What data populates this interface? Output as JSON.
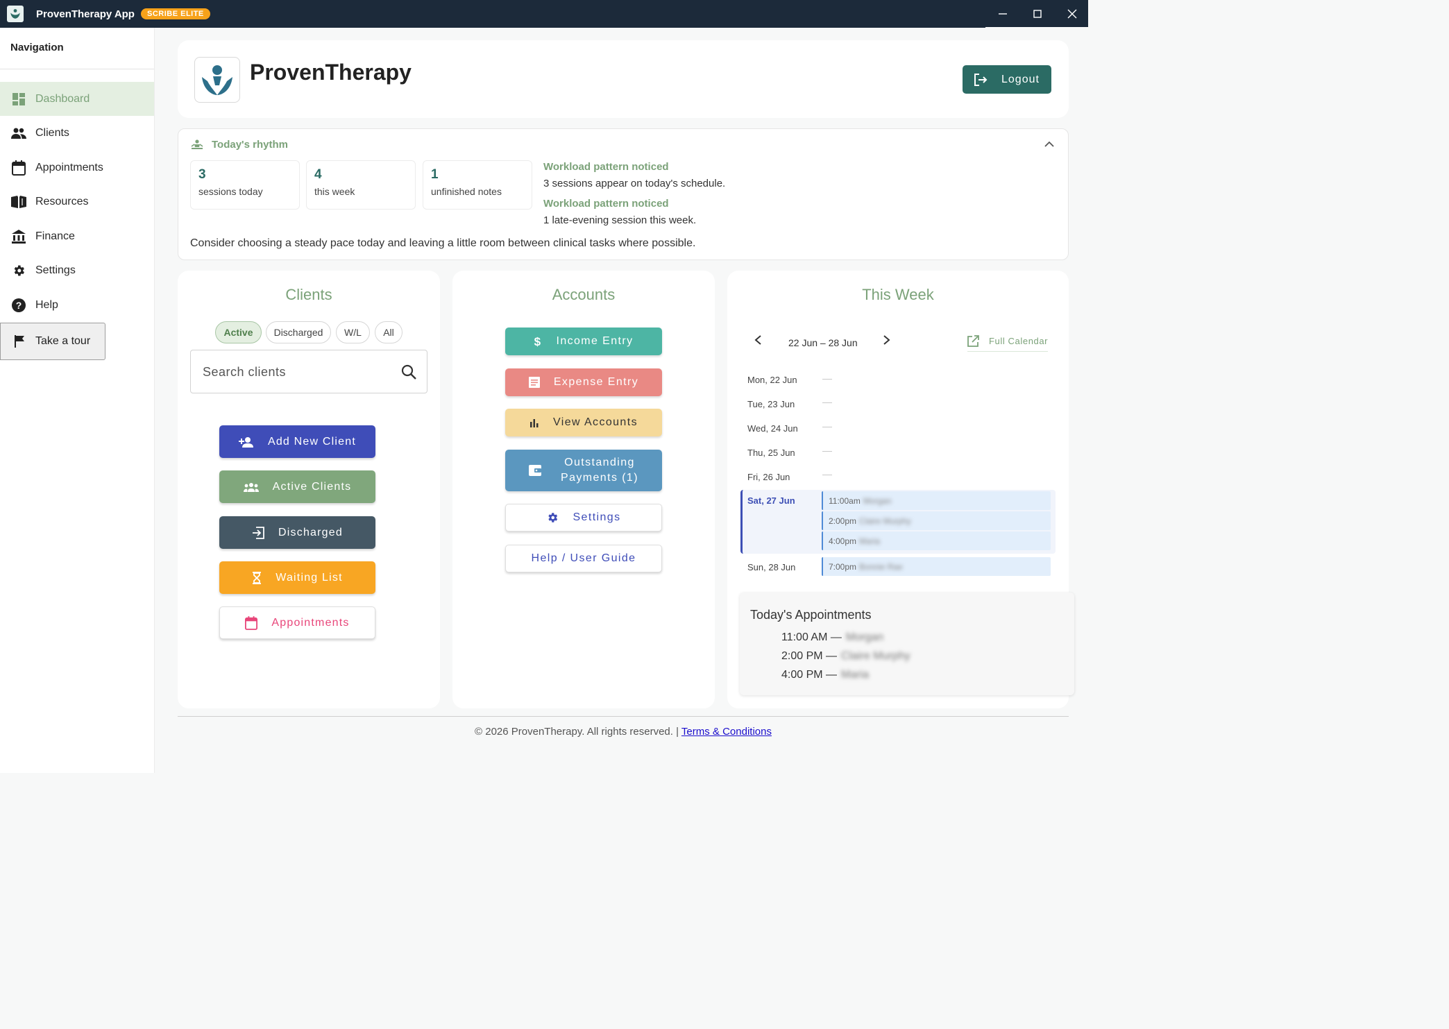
{
  "window": {
    "title": "ProvenTherapy App",
    "badge": "SCRIBE ELITE"
  },
  "sidebar": {
    "title": "Navigation",
    "items": [
      {
        "label": "Dashboard",
        "icon": "dashboard-icon",
        "active": true
      },
      {
        "label": "Clients",
        "icon": "people-icon"
      },
      {
        "label": "Appointments",
        "icon": "calendar-icon"
      },
      {
        "label": "Resources",
        "icon": "book-icon"
      },
      {
        "label": "Finance",
        "icon": "bank-icon"
      },
      {
        "label": "Settings",
        "icon": "gear-icon"
      },
      {
        "label": "Help",
        "icon": "help-icon"
      }
    ],
    "tour_label": "Take a tour"
  },
  "header": {
    "brand": "ProvenTherapy",
    "logout_label": "Logout"
  },
  "rhythm": {
    "title": "Today's rhythm",
    "stats": [
      {
        "value": "3",
        "caption": "sessions today"
      },
      {
        "value": "4",
        "caption": "this week"
      },
      {
        "value": "1",
        "caption": "unfinished notes"
      }
    ],
    "insights": [
      {
        "title": "Workload pattern noticed",
        "text": "3 sessions appear on today's schedule."
      },
      {
        "title": "Workload pattern noticed",
        "text": "1 late-evening session this week."
      }
    ],
    "tip": "Consider choosing a steady pace today and leaving a little room between clinical tasks where possible."
  },
  "clients": {
    "title": "Clients",
    "filters": [
      "Active",
      "Discharged",
      "W/L",
      "All"
    ],
    "active_filter": "Active",
    "search_placeholder": "Search clients",
    "buttons": [
      {
        "label": "Add New Client",
        "icon": "person-add-icon",
        "color": "#3f4db8"
      },
      {
        "label": "Active Clients",
        "icon": "group-icon",
        "color": "#80a77c"
      },
      {
        "label": "Discharged",
        "icon": "exit-icon",
        "color": "#455865"
      },
      {
        "label": "Waiting List",
        "icon": "hourglass-icon",
        "color": "#f8a623"
      },
      {
        "label": "Appointments",
        "icon": "calendar-icon",
        "color": "#e8467a"
      }
    ]
  },
  "accounts": {
    "title": "Accounts",
    "buttons": [
      {
        "label": "Income Entry",
        "icon": "dollar-icon",
        "color": "#4db5a4"
      },
      {
        "label": "Expense Entry",
        "icon": "receipt-icon",
        "color": "#e98984"
      },
      {
        "label": "View Accounts",
        "icon": "bar-chart-icon",
        "color": "#f5d99a"
      },
      {
        "label": "Outstanding Payments (1)",
        "label_line1": "Outstanding",
        "label_line2": "Payments (1)",
        "icon": "wallet-icon",
        "color": "#5b97bf"
      },
      {
        "label": "Settings",
        "icon": "gear-icon",
        "color": "#3f4db8"
      },
      {
        "label": "Help / User Guide",
        "color": "#3f4db8"
      }
    ]
  },
  "week": {
    "title": "This Week",
    "range": "22 Jun – 28 Jun",
    "full_calendar_label": "Full Calendar",
    "days": [
      {
        "label": "Mon, 22 Jun",
        "appointments": []
      },
      {
        "label": "Tue, 23 Jun",
        "appointments": []
      },
      {
        "label": "Wed, 24 Jun",
        "appointments": []
      },
      {
        "label": "Thu, 25 Jun",
        "appointments": []
      },
      {
        "label": "Fri, 26 Jun",
        "appointments": []
      },
      {
        "label": "Sat, 27 Jun",
        "today": true,
        "appointments": [
          {
            "time": "11:00am",
            "name": "Morgan"
          },
          {
            "time": "2:00pm",
            "name": "Claire Murphy"
          },
          {
            "time": "4:00pm",
            "name": "Maria"
          }
        ]
      },
      {
        "label": "Sun, 28 Jun",
        "appointments": [
          {
            "time": "7:00pm",
            "name": "Bonnie Rae"
          }
        ]
      }
    ],
    "today_title": "Today's Appointments",
    "today_list": [
      {
        "time": "11:00 AM",
        "name": "Morgan"
      },
      {
        "time": "2:00 PM",
        "name": "Claire Murphy"
      },
      {
        "time": "4:00 PM",
        "name": "Maria"
      }
    ]
  },
  "footer": {
    "text": "© 2026 ProvenTherapy. All rights reserved. |",
    "link": "Terms & Conditions"
  },
  "colors": {
    "accent_green": "#7ba279",
    "teal": "#2b6b64",
    "titlebar": "#1c2a3a",
    "indigo": "#3f4db8"
  }
}
